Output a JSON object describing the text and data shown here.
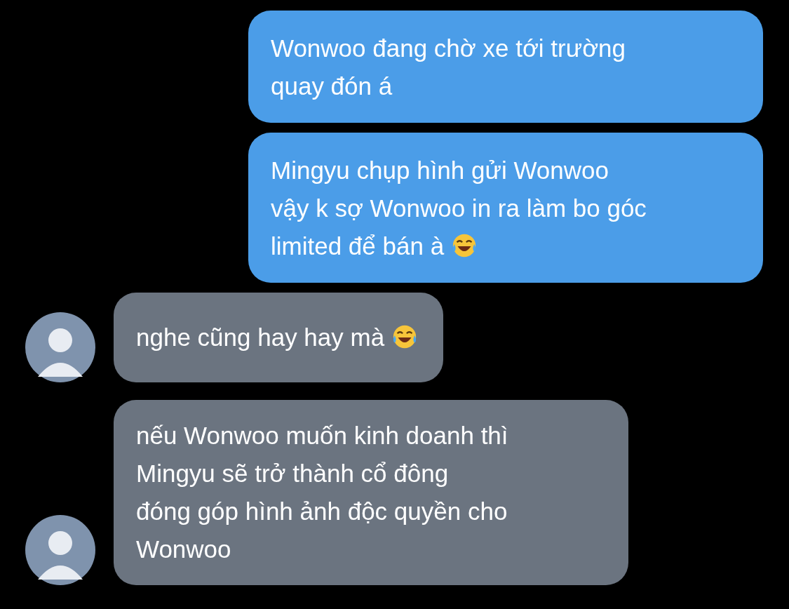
{
  "messages": [
    {
      "kind": "outgoing",
      "lines": [
        "Wonwoo đang chờ xe tới trường",
        "quay đón á"
      ]
    },
    {
      "kind": "outgoing",
      "lines": [
        "Mingyu chụp hình gửi Wonwoo",
        "vậy k sợ Wonwoo in ra làm bo góc",
        "limited để bán à"
      ],
      "emoji": true
    },
    {
      "kind": "incoming",
      "lines": [
        "nghe cũng hay hay mà"
      ],
      "emoji": true,
      "avatar": true
    },
    {
      "kind": "incoming",
      "lines": [
        "nếu Wonwoo muốn kinh doanh thì",
        "Mingyu sẽ trở thành cổ đông",
        "đóng góp hình ảnh độc quyền cho",
        "Wonwoo"
      ],
      "avatar": true
    }
  ]
}
